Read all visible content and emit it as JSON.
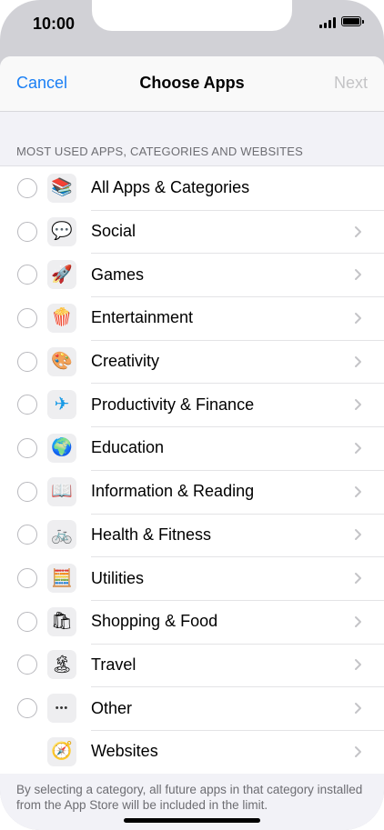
{
  "status": {
    "time": "10:00"
  },
  "nav": {
    "cancel": "Cancel",
    "title": "Choose Apps",
    "next": "Next"
  },
  "section_header": "MOST USED APPS, CATEGORIES AND WEBSITES",
  "items": [
    {
      "label": "All Apps & Categories",
      "icon": "stack-layers-icon",
      "glyph": "📚",
      "radio": true,
      "chevron": false
    },
    {
      "label": "Social",
      "icon": "speech-bubble-heart-icon",
      "glyph": "💬",
      "radio": true,
      "chevron": true
    },
    {
      "label": "Games",
      "icon": "rocket-icon",
      "glyph": "🚀",
      "radio": true,
      "chevron": true
    },
    {
      "label": "Entertainment",
      "icon": "popcorn-icon",
      "glyph": "🍿",
      "radio": true,
      "chevron": true
    },
    {
      "label": "Creativity",
      "icon": "paint-palette-icon",
      "glyph": "🎨",
      "radio": true,
      "chevron": true
    },
    {
      "label": "Productivity & Finance",
      "icon": "paper-plane-icon",
      "glyph": "✈",
      "radio": true,
      "chevron": true
    },
    {
      "label": "Education",
      "icon": "globe-icon",
      "glyph": "🌍",
      "radio": true,
      "chevron": true
    },
    {
      "label": "Information & Reading",
      "icon": "open-book-icon",
      "glyph": "📖",
      "radio": true,
      "chevron": true
    },
    {
      "label": "Health & Fitness",
      "icon": "bicycle-icon",
      "glyph": "🚲",
      "radio": true,
      "chevron": true
    },
    {
      "label": "Utilities",
      "icon": "calculator-icon",
      "glyph": "🧮",
      "radio": true,
      "chevron": true
    },
    {
      "label": "Shopping & Food",
      "icon": "shopping-bag-icon",
      "glyph": "🛍",
      "radio": true,
      "chevron": true
    },
    {
      "label": "Travel",
      "icon": "palm-island-icon",
      "glyph": "🏝",
      "radio": true,
      "chevron": true
    },
    {
      "label": "Other",
      "icon": "ellipsis-icon",
      "glyph": "•••",
      "radio": true,
      "chevron": true
    },
    {
      "label": "Websites",
      "icon": "compass-icon",
      "glyph": "🧭",
      "radio": false,
      "chevron": true
    }
  ],
  "footer": "By selecting a category, all future apps in that category installed from the App Store will be included in the limit.",
  "colors": {
    "accent": "#1a7ff5",
    "disabled": "#c4c4c6",
    "secondary_text": "#6d6d72",
    "grouped_bg": "#f2f2f7"
  }
}
